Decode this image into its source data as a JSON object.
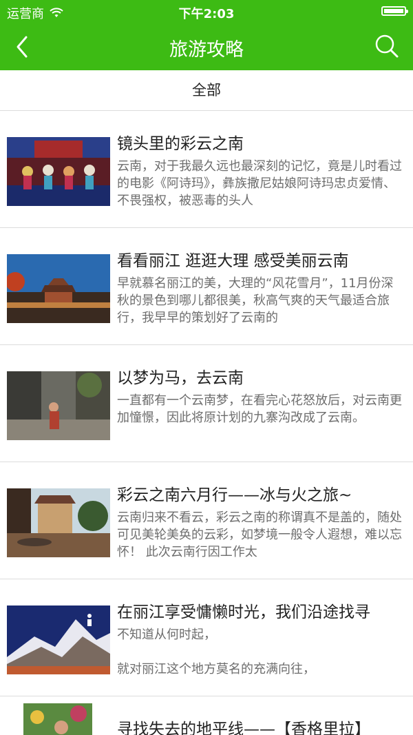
{
  "status": {
    "carrier": "运营商",
    "time": "下午2:03"
  },
  "nav": {
    "title": "旅游攻略"
  },
  "filter": {
    "label": "全部"
  },
  "articles": [
    {
      "title": "镜头里的彩云之南",
      "desc": "云南，对于我最久远也最深刻的记忆，竟是儿时看过的电影《阿诗玛》，彝族撒尼姑娘阿诗玛忠贞爱情、不畏强权，被恶毒的头人",
      "image": "dancers-stage"
    },
    {
      "title": "看看丽江 逛逛大理 感受美丽云南",
      "desc": "早就慕名丽江的美，大理的“风花雪月”，11月份深秋的景色到哪儿都很美，秋高气爽的天气最适合旅行，我早早的策划好了云南的",
      "image": "pagoda-sunset"
    },
    {
      "title": "以梦为马，去云南",
      "desc": "一直都有一个云南梦，在看完心花怒放后，对云南更加憧憬，因此将原计划的九寨沟改成了云南。",
      "image": "old-town-lane"
    },
    {
      "title": "彩云之南六月行——冰与火之旅~",
      "desc": "云南归来不看云，彩云之南的称谓真不是盖的，随处可见美轮美奂的云彩，如梦境一般令人遐想，难以忘怀！ 此次云南行因工作太",
      "image": "courtyard-hotel"
    },
    {
      "title": "在丽江享受慵懒时光，我们沿途找寻",
      "desc": "不知道从何时起，\n\n就对丽江这个地方莫名的充满向往，",
      "image": "snow-mountain"
    },
    {
      "title": "寻找失去的地平线——【香格里拉】",
      "desc": "",
      "image": "woman-flowers"
    }
  ]
}
